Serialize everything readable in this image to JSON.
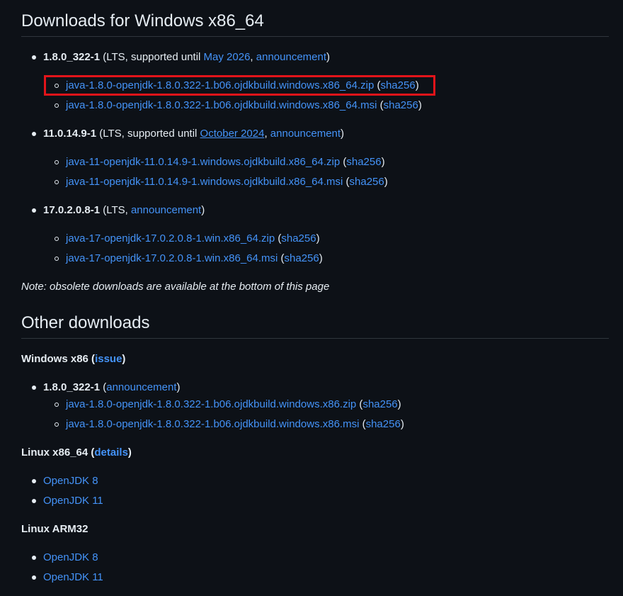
{
  "section_windows": {
    "title": "Downloads for Windows x86_64",
    "releases": [
      {
        "version": "1.8.0_322-1",
        "meta_prefix": " (LTS, supported until ",
        "support_link": "May 2026",
        "sep": ", ",
        "announcement": "announcement",
        "meta_suffix": ")",
        "files": [
          {
            "name": "java-1.8.0-openjdk-1.8.0.322-1.b06.ojdkbuild.windows.x86_64.zip",
            "sha": "sha256"
          },
          {
            "name": "java-1.8.0-openjdk-1.8.0.322-1.b06.ojdkbuild.windows.x86_64.msi",
            "sha": "sha256"
          }
        ]
      },
      {
        "version": "11.0.14.9-1",
        "meta_prefix": " (LTS, supported until ",
        "support_link": "October 2024",
        "sep": ", ",
        "announcement": "announcement",
        "meta_suffix": ")",
        "files": [
          {
            "name": "java-11-openjdk-11.0.14.9-1.windows.ojdkbuild.x86_64.zip",
            "sha": "sha256"
          },
          {
            "name": "java-11-openjdk-11.0.14.9-1.windows.ojdkbuild.x86_64.msi",
            "sha": "sha256"
          }
        ]
      },
      {
        "version": "17.0.2.0.8-1",
        "meta_prefix": " (LTS, ",
        "announcement": "announcement",
        "meta_suffix": ")",
        "files": [
          {
            "name": "java-17-openjdk-17.0.2.0.8-1.win.x86_64.zip",
            "sha": "sha256"
          },
          {
            "name": "java-17-openjdk-17.0.2.0.8-1.win.x86_64.msi",
            "sha": "sha256"
          }
        ]
      }
    ],
    "note": "Note: obsolete downloads are available at the bottom of this page"
  },
  "section_other": {
    "title": "Other downloads",
    "win_x86": {
      "label": "Windows x86",
      "open": " (",
      "link": "issue",
      "close": ")",
      "release": {
        "version": "1.8.0_322-1",
        "open": " (",
        "announcement": "announcement",
        "close": ")",
        "files": [
          {
            "name": "java-1.8.0-openjdk-1.8.0.322-1.b06.ojdkbuild.windows.x86.zip",
            "sha": "sha256"
          },
          {
            "name": "java-1.8.0-openjdk-1.8.0.322-1.b06.ojdkbuild.windows.x86.msi",
            "sha": "sha256"
          }
        ]
      }
    },
    "linux_x86_64": {
      "label": "Linux x86_64",
      "open": " (",
      "link": "details",
      "close": ")",
      "items": [
        "OpenJDK 8",
        "OpenJDK 11"
      ]
    },
    "linux_arm32": {
      "label": "Linux ARM32",
      "items": [
        "OpenJDK 8",
        "OpenJDK 11"
      ]
    }
  },
  "punct": {
    "paren_open": " (",
    "paren_close": ")"
  },
  "colors": {
    "background": "#0d1117",
    "text": "#e6edf3",
    "link": "#4493f8",
    "highlight": "#e3141a"
  }
}
